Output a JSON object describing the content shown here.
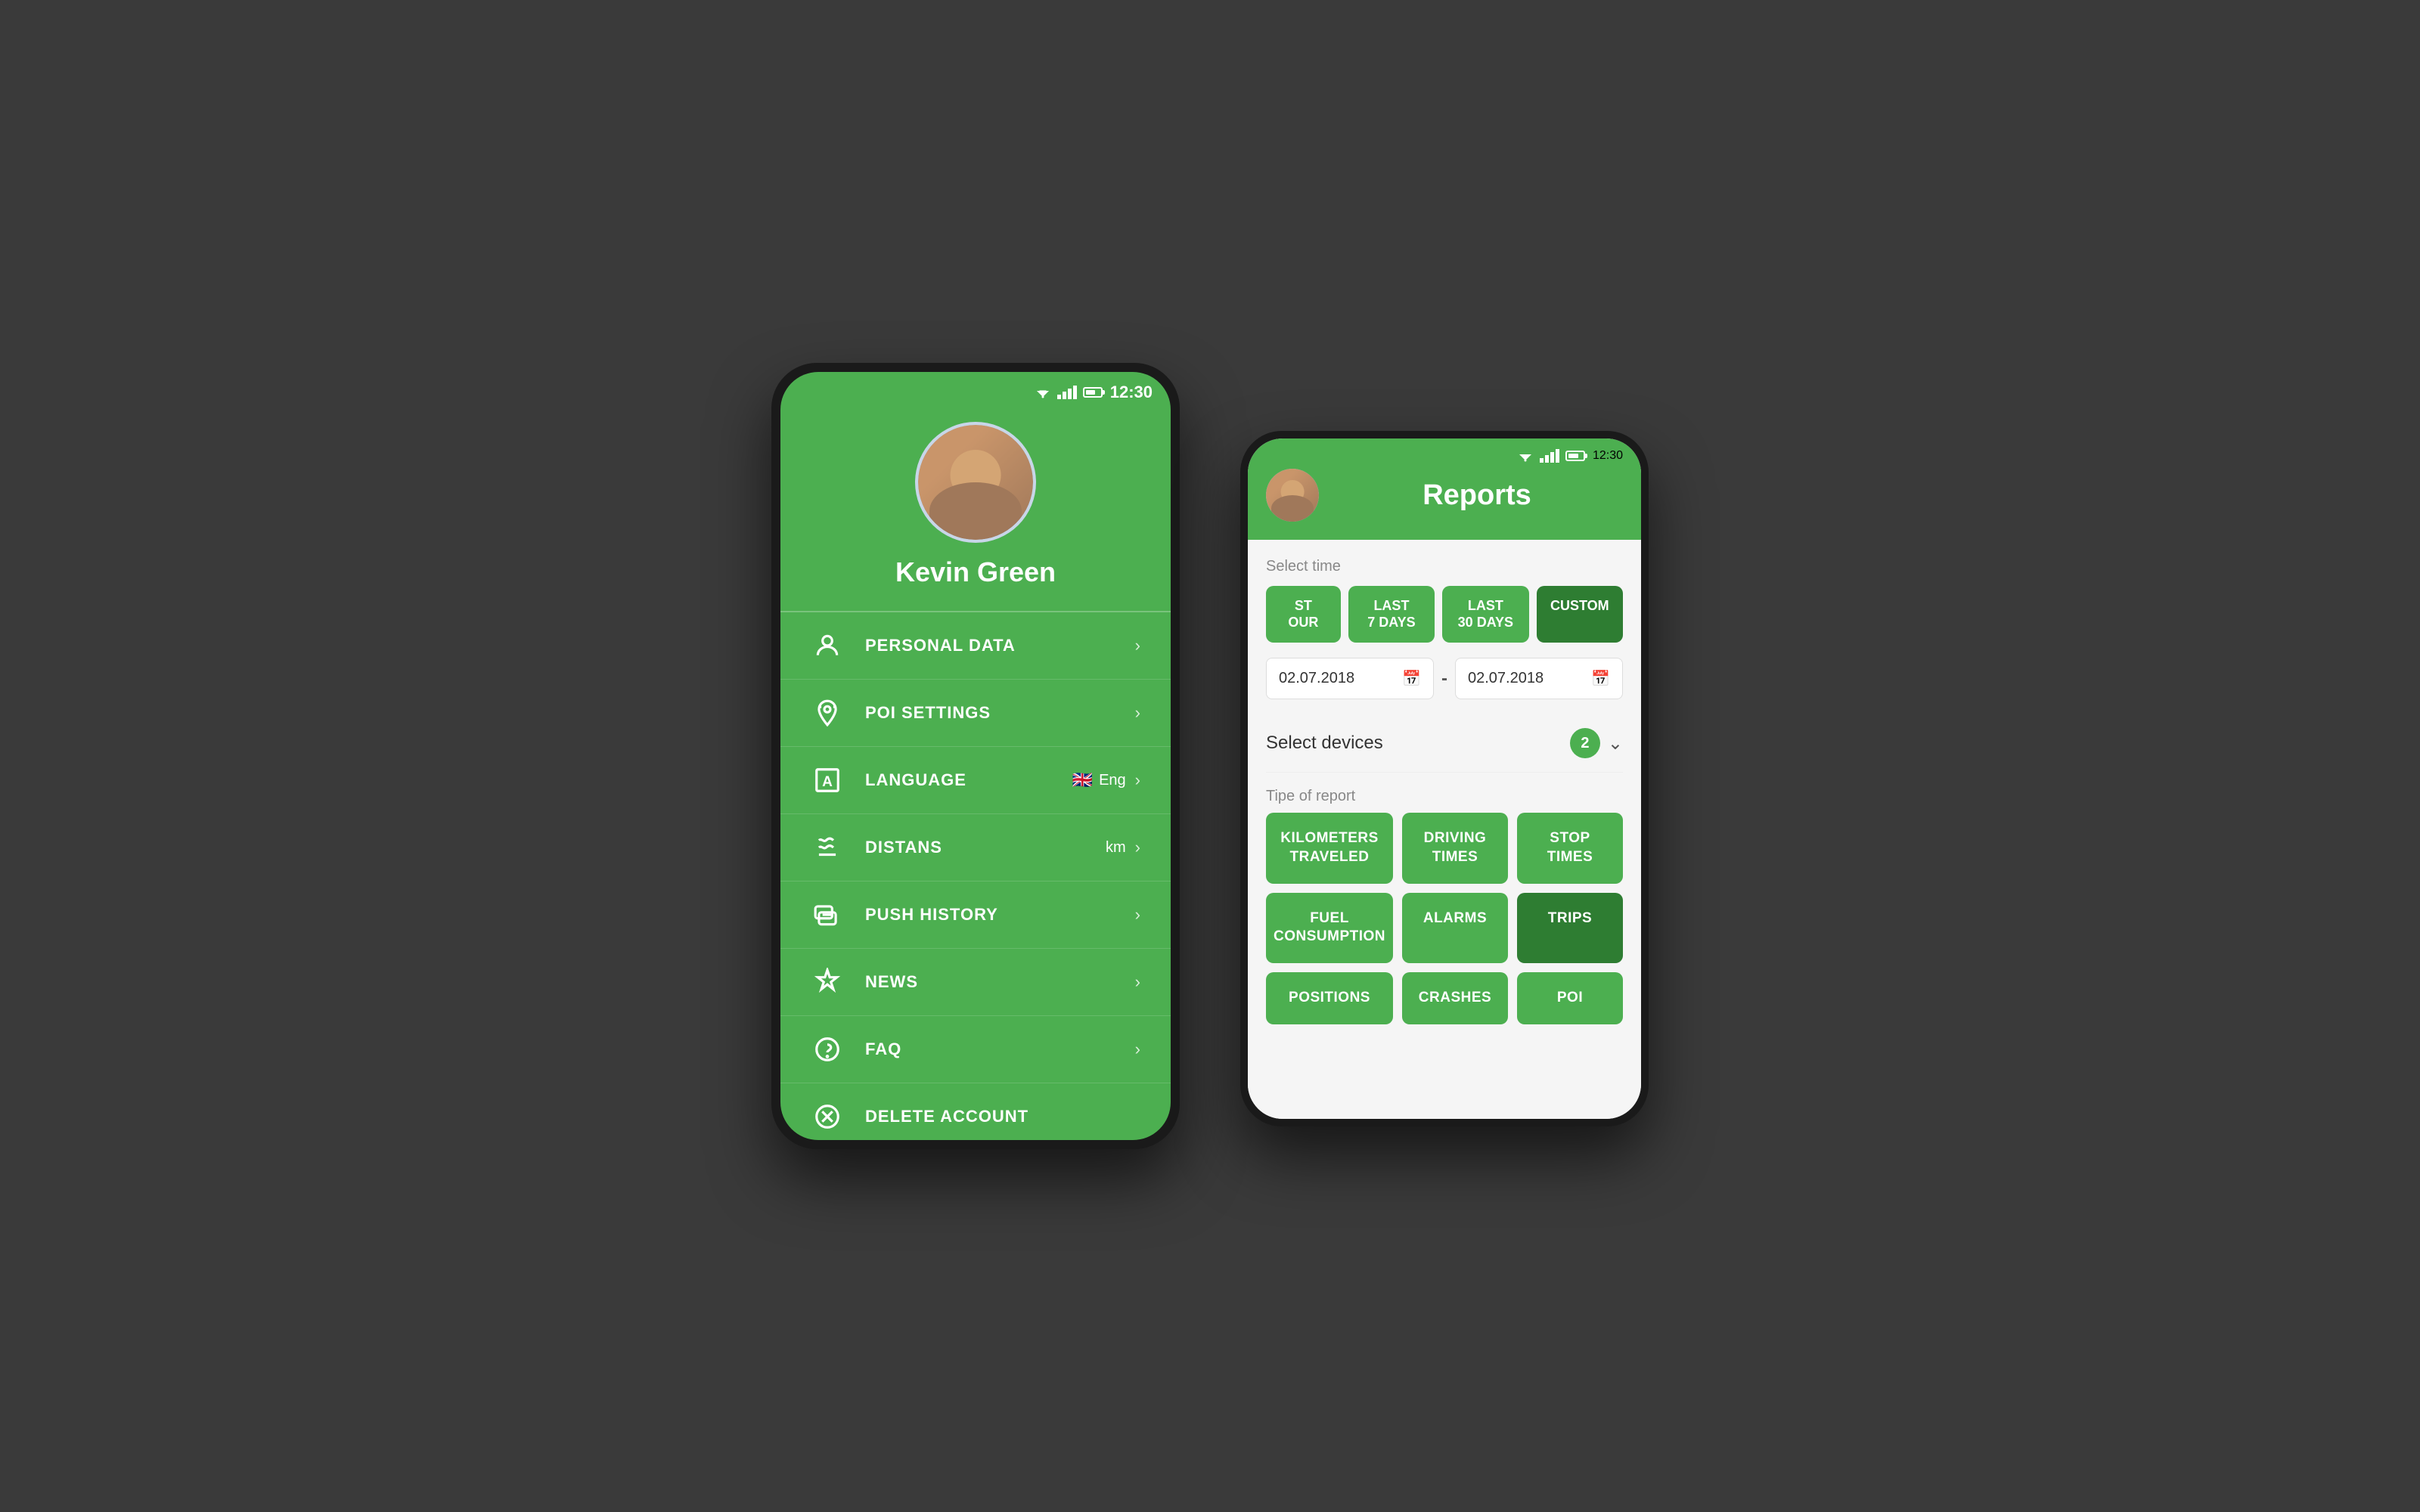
{
  "background": "#3a3a3a",
  "phone1": {
    "status_bar": {
      "time": "12:30"
    },
    "profile": {
      "user_name": "Kevin Green"
    },
    "menu_items": [
      {
        "id": "personal-data",
        "label": "PERSONAL DATA",
        "icon": "person",
        "value": "",
        "has_chevron": true
      },
      {
        "id": "poi-settings",
        "label": "POI SETTINGS",
        "icon": "poi",
        "value": "",
        "has_chevron": true
      },
      {
        "id": "language",
        "label": "LANGUAGE",
        "icon": "language",
        "value": "Eng",
        "has_flag": true,
        "has_chevron": true
      },
      {
        "id": "distans",
        "label": "DISTANS",
        "icon": "route",
        "value": "km",
        "has_chevron": true
      },
      {
        "id": "push-history",
        "label": "PUSH HISTORY",
        "icon": "push",
        "value": "",
        "has_chevron": true
      },
      {
        "id": "news",
        "label": "NEWS",
        "icon": "news",
        "value": "",
        "has_chevron": true
      },
      {
        "id": "faq",
        "label": "FAQ",
        "icon": "faq",
        "value": "",
        "has_chevron": true
      },
      {
        "id": "delete-account",
        "label": "DELETE ACCOUNT",
        "icon": "delete",
        "value": "",
        "has_chevron": false
      }
    ]
  },
  "phone2": {
    "status_bar": {
      "time": "12:30"
    },
    "header": {
      "title": "Reports"
    },
    "select_time_label": "Select time",
    "time_buttons": [
      {
        "id": "last-hour",
        "label": "ST\nOUR",
        "active": false,
        "partial": true
      },
      {
        "id": "last-7-days",
        "label": "LAST\n7 DAYS",
        "active": false
      },
      {
        "id": "last-30-days",
        "label": "LAST\n30 DAYS",
        "active": false
      },
      {
        "id": "custom",
        "label": "CUSTOM",
        "active": true
      }
    ],
    "date_from": "02.07.2018",
    "date_to": "02.07.2018",
    "select_devices_label": "Select devices",
    "devices_count": "2",
    "type_of_report_label": "Tipe of report",
    "report_types": [
      {
        "id": "km-traveled",
        "label": "KILOMETERS\nTRAVELED",
        "dark": false
      },
      {
        "id": "driving-times",
        "label": "DRIVING\nTIMES",
        "dark": false
      },
      {
        "id": "stop-times",
        "label": "STOP\nTIMES",
        "dark": false
      },
      {
        "id": "fuel-consumption",
        "label": "FUEL\nCONSUMPTION",
        "dark": false
      },
      {
        "id": "alarms",
        "label": "ALARMS",
        "dark": false
      },
      {
        "id": "trips",
        "label": "TRIPS",
        "dark": true
      },
      {
        "id": "positions",
        "label": "POSITIONS",
        "dark": false
      },
      {
        "id": "crashes",
        "label": "CRASHES",
        "dark": false
      },
      {
        "id": "poi",
        "label": "POI",
        "dark": false
      }
    ]
  }
}
